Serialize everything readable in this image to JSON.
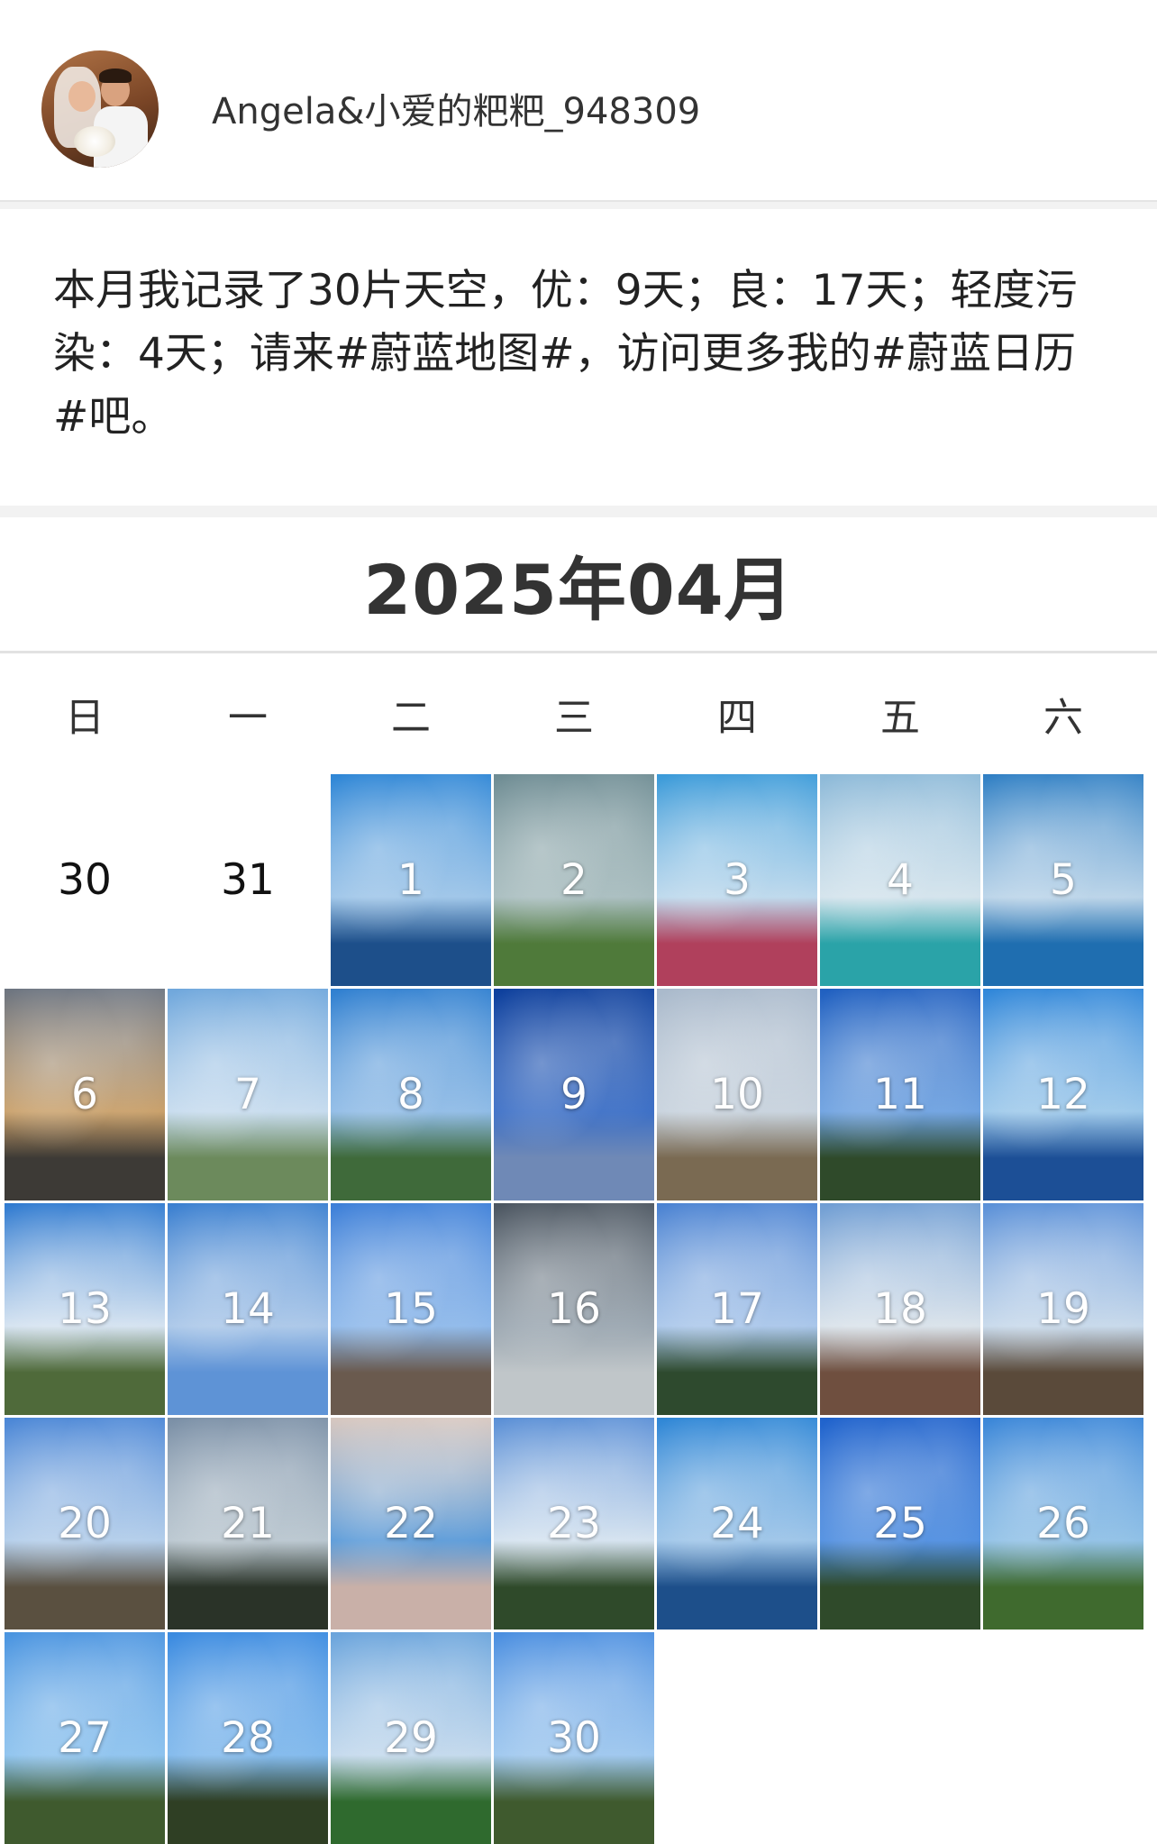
{
  "user": {
    "name": "Angela&小爱的粑粑_948309"
  },
  "post": {
    "text": "本月我记录了30片天空，优：9天；良：17天；轻度污染：4天；请来#蔚蓝地图#，访问更多我的#蔚蓝日历#吧。"
  },
  "calendar": {
    "title": "2025年04月",
    "weekdays": [
      "日",
      "一",
      "二",
      "三",
      "四",
      "五",
      "六"
    ],
    "leading_days": [
      "30",
      "31"
    ],
    "days": [
      {
        "day": "1",
        "colors": [
          "#2e86d6",
          "#9cc4e8",
          "#1d4f8a"
        ]
      },
      {
        "day": "2",
        "colors": [
          "#6e8c93",
          "#a7bcbe",
          "#4f7a3a"
        ]
      },
      {
        "day": "3",
        "colors": [
          "#3a9ad9",
          "#bcd8ec",
          "#b0405c"
        ]
      },
      {
        "day": "4",
        "colors": [
          "#8cb9d8",
          "#d3e3ec",
          "#2aa3a8"
        ]
      },
      {
        "day": "5",
        "colors": [
          "#2f7fc4",
          "#b9d3e8",
          "#1f6eb0"
        ]
      },
      {
        "day": "6",
        "colors": [
          "#6d7581",
          "#c9a06a",
          "#3d3a36"
        ]
      },
      {
        "day": "7",
        "colors": [
          "#6fa7dc",
          "#c6dbee",
          "#6c8a5c"
        ]
      },
      {
        "day": "8",
        "colors": [
          "#2f7fd0",
          "#8fbbe6",
          "#3f6a3a"
        ]
      },
      {
        "day": "9",
        "colors": [
          "#0d3f9c",
          "#3c6fc6",
          "#6f89b6"
        ]
      },
      {
        "day": "10",
        "colors": [
          "#a9b9cb",
          "#c7d2dd",
          "#7a6a52"
        ]
      },
      {
        "day": "11",
        "colors": [
          "#1f5fc0",
          "#6da1e0",
          "#2f4a2a"
        ]
      },
      {
        "day": "12",
        "colors": [
          "#2f86d9",
          "#9cc8ea",
          "#1c4f96"
        ]
      },
      {
        "day": "13",
        "colors": [
          "#2f7ad0",
          "#d4e2f0",
          "#4f6a3a"
        ]
      },
      {
        "day": "14",
        "colors": [
          "#3a7fd0",
          "#a9c6e8",
          "#5e93d6"
        ]
      },
      {
        "day": "15",
        "colors": [
          "#3d7fd8",
          "#8db8ea",
          "#6a5a4e"
        ]
      },
      {
        "day": "16",
        "colors": [
          "#4b5560",
          "#9aa6b0",
          "#c0c6c9"
        ]
      },
      {
        "day": "17",
        "colors": [
          "#4a82d2",
          "#a9c6ea",
          "#2e4a2e"
        ]
      },
      {
        "day": "18",
        "colors": [
          "#6f9dd3",
          "#d9e2ea",
          "#6f4f3f"
        ]
      },
      {
        "day": "19",
        "colors": [
          "#5a90d8",
          "#c6d8ea",
          "#5a4a3a"
        ]
      },
      {
        "day": "20",
        "colors": [
          "#4a86d6",
          "#b2cdea",
          "#5a5040"
        ]
      },
      {
        "day": "21",
        "colors": [
          "#7a8fa6",
          "#b9c6cf",
          "#2a3328"
        ]
      },
      {
        "day": "22",
        "colors": [
          "#d8c8c0",
          "#5a9ad8",
          "#c9b0a8"
        ]
      },
      {
        "day": "23",
        "colors": [
          "#5a8fd6",
          "#d4e2ef",
          "#2f4a2a"
        ]
      },
      {
        "day": "24",
        "colors": [
          "#2e86d6",
          "#9cc4e8",
          "#1d4f8a"
        ]
      },
      {
        "day": "25",
        "colors": [
          "#1f62cc",
          "#4f8ee0",
          "#2f4a2a"
        ]
      },
      {
        "day": "26",
        "colors": [
          "#3a86d8",
          "#8fc0e6",
          "#3f6a2e"
        ]
      },
      {
        "day": "27",
        "colors": [
          "#4a94e0",
          "#8cc2ee",
          "#3f5a2e"
        ]
      },
      {
        "day": "28",
        "colors": [
          "#3a8ae0",
          "#7fb8ec",
          "#2f3f24"
        ]
      },
      {
        "day": "29",
        "colors": [
          "#6aa4dc",
          "#c2d8ec",
          "#2f6a2e"
        ]
      },
      {
        "day": "30",
        "colors": [
          "#4a8ee0",
          "#9cc6ee",
          "#3f5a2e"
        ]
      }
    ]
  }
}
